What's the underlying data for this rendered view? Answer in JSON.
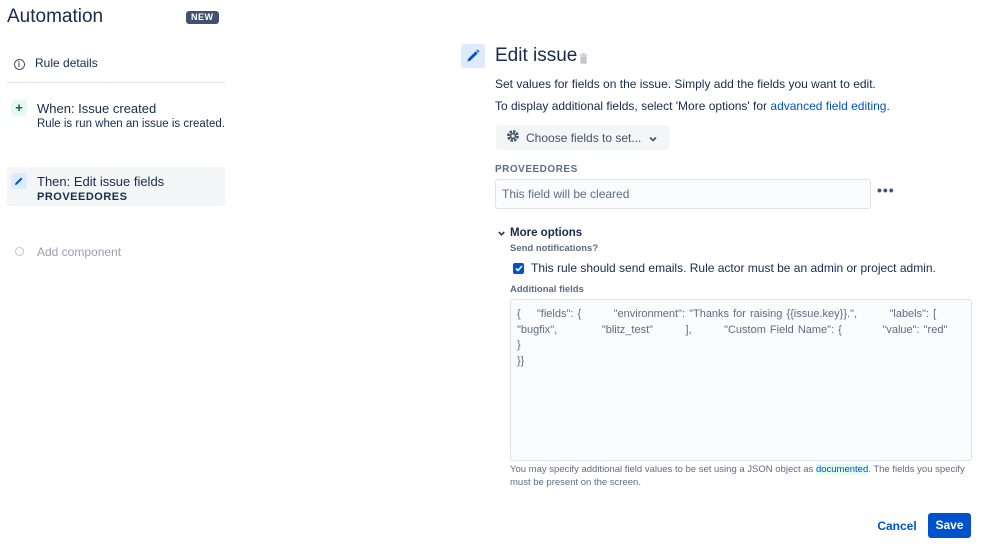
{
  "app": {
    "title": "Automation",
    "badge": "NEW"
  },
  "sidebar": {
    "rule_details": {
      "label": "Rule details",
      "icon": "info-icon"
    },
    "trigger": {
      "title": "When: Issue created",
      "subtitle": "Rule is run when an issue is created.",
      "icon": "plus-icon"
    },
    "action": {
      "title": "Then: Edit issue fields",
      "subtitle": "PROVEEDORES",
      "icon": "pencil-icon"
    },
    "add_component": {
      "label": "Add component"
    }
  },
  "main": {
    "title": "Edit issue",
    "desc1": "Set values for fields on the issue. Simply add the fields you want to edit.",
    "desc2_prefix": "To display additional fields, select 'More options' for ",
    "desc2_link": "advanced field editing",
    "desc2_suffix": ".",
    "choose_fields_label": "Choose fields to set...",
    "field_label": "PROVEEDORES",
    "field_placeholder": "This field will be cleared",
    "more_options_label": "More options",
    "send_notifications_label": "Send notifications?",
    "send_emails_label": "This rule should send emails. Rule actor must be an admin or project admin.",
    "send_emails_checked": true,
    "additional_fields_label": "Additional fields",
    "additional_fields_value": "{    \"fields\": {        \"environment\": \"Thanks for raising {{issue.key}}.\",        \"labels\": [\n\"bugfix\",           \"blitz_test\"        ],        \"Custom Field Name\": {          \"value\": \"red\"       }\n}}",
    "help_prefix": "You may specify additional field values to be set using a JSON object as ",
    "help_link": "documented",
    "help_suffix": ". The fields you specify must be present on the screen.",
    "cancel_label": "Cancel",
    "save_label": "Save"
  },
  "colors": {
    "primary": "#0052cc",
    "text": "#172b4d",
    "subtle": "#5e6c84",
    "selected_bg": "#f4f5f7"
  }
}
